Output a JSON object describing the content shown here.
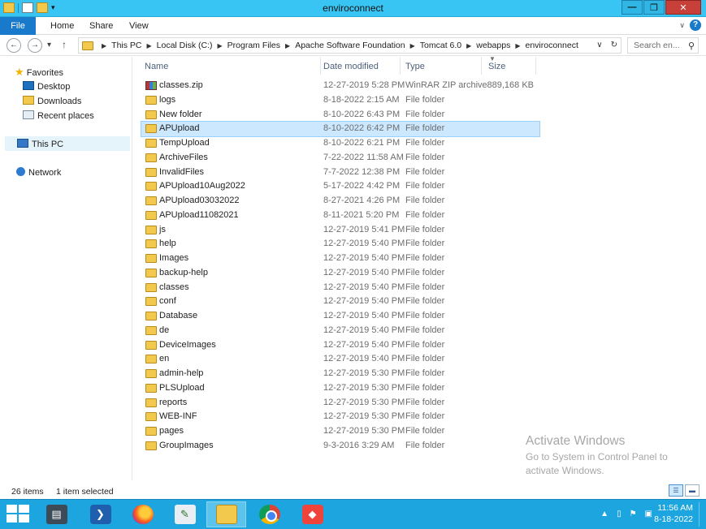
{
  "window": {
    "title": "enviroconnect",
    "controls": {
      "minimize": "—",
      "maximize": "❐",
      "close": "✕"
    }
  },
  "ribbon": {
    "tabs": [
      "File",
      "Home",
      "Share",
      "View"
    ],
    "help": "?"
  },
  "navigation": {
    "back": "←",
    "forward": "→",
    "recent": "▾",
    "up": "↑",
    "breadcrumbs": [
      "This PC",
      "Local Disk (C:)",
      "Program Files",
      "Apache Software Foundation",
      "Tomcat 6.0",
      "webapps",
      "enviroconnect"
    ],
    "dropdown": "∨",
    "refresh": "↻",
    "search_placeholder": "Search en...",
    "search_icon": "search-icon"
  },
  "nav_pane": {
    "favorites_label": "Favorites",
    "favorites": [
      "Desktop",
      "Downloads",
      "Recent places"
    ],
    "this_pc": "This PC",
    "network": "Network"
  },
  "columns": {
    "name": "Name",
    "date": "Date modified",
    "type": "Type",
    "size": "Size"
  },
  "files": [
    {
      "name": "classes.zip",
      "date": "12-27-2019 5:28 PM",
      "type": "WinRAR ZIP archive",
      "size": "889,168 KB",
      "icon": "zip"
    },
    {
      "name": "logs",
      "date": "8-18-2022 2:15 AM",
      "type": "File folder",
      "size": "",
      "icon": "folder"
    },
    {
      "name": "New folder",
      "date": "8-10-2022 6:43 PM",
      "type": "File folder",
      "size": "",
      "icon": "folder"
    },
    {
      "name": "APUpload",
      "date": "8-10-2022 6:42 PM",
      "type": "File folder",
      "size": "",
      "icon": "folder",
      "selected": true
    },
    {
      "name": "TempUpload",
      "date": "8-10-2022 6:21 PM",
      "type": "File folder",
      "size": "",
      "icon": "folder"
    },
    {
      "name": "ArchiveFiles",
      "date": "7-22-2022 11:58 AM",
      "type": "File folder",
      "size": "",
      "icon": "folder"
    },
    {
      "name": "InvalidFiles",
      "date": "7-7-2022 12:38 PM",
      "type": "File folder",
      "size": "",
      "icon": "folder"
    },
    {
      "name": "APUpload10Aug2022",
      "date": "5-17-2022 4:42 PM",
      "type": "File folder",
      "size": "",
      "icon": "folder"
    },
    {
      "name": "APUpload03032022",
      "date": "8-27-2021 4:26 PM",
      "type": "File folder",
      "size": "",
      "icon": "folder"
    },
    {
      "name": "APUpload11082021",
      "date": "8-11-2021 5:20 PM",
      "type": "File folder",
      "size": "",
      "icon": "folder"
    },
    {
      "name": "js",
      "date": "12-27-2019 5:41 PM",
      "type": "File folder",
      "size": "",
      "icon": "folder"
    },
    {
      "name": "help",
      "date": "12-27-2019 5:40 PM",
      "type": "File folder",
      "size": "",
      "icon": "folder"
    },
    {
      "name": "Images",
      "date": "12-27-2019 5:40 PM",
      "type": "File folder",
      "size": "",
      "icon": "folder"
    },
    {
      "name": "backup-help",
      "date": "12-27-2019 5:40 PM",
      "type": "File folder",
      "size": "",
      "icon": "folder"
    },
    {
      "name": "classes",
      "date": "12-27-2019 5:40 PM",
      "type": "File folder",
      "size": "",
      "icon": "folder"
    },
    {
      "name": "conf",
      "date": "12-27-2019 5:40 PM",
      "type": "File folder",
      "size": "",
      "icon": "folder"
    },
    {
      "name": "Database",
      "date": "12-27-2019 5:40 PM",
      "type": "File folder",
      "size": "",
      "icon": "folder"
    },
    {
      "name": "de",
      "date": "12-27-2019 5:40 PM",
      "type": "File folder",
      "size": "",
      "icon": "folder"
    },
    {
      "name": "DeviceImages",
      "date": "12-27-2019 5:40 PM",
      "type": "File folder",
      "size": "",
      "icon": "folder"
    },
    {
      "name": "en",
      "date": "12-27-2019 5:40 PM",
      "type": "File folder",
      "size": "",
      "icon": "folder"
    },
    {
      "name": "admin-help",
      "date": "12-27-2019 5:30 PM",
      "type": "File folder",
      "size": "",
      "icon": "folder"
    },
    {
      "name": "PLSUpload",
      "date": "12-27-2019 5:30 PM",
      "type": "File folder",
      "size": "",
      "icon": "folder"
    },
    {
      "name": "reports",
      "date": "12-27-2019 5:30 PM",
      "type": "File folder",
      "size": "",
      "icon": "folder"
    },
    {
      "name": "WEB-INF",
      "date": "12-27-2019 5:30 PM",
      "type": "File folder",
      "size": "",
      "icon": "folder"
    },
    {
      "name": "pages",
      "date": "12-27-2019 5:30 PM",
      "type": "File folder",
      "size": "",
      "icon": "folder"
    },
    {
      "name": "GroupImages",
      "date": "9-3-2016 3:29 AM",
      "type": "File folder",
      "size": "",
      "icon": "folder"
    }
  ],
  "watermark": {
    "title": "Activate Windows",
    "subtitle": "Go to System in Control Panel to activate Windows."
  },
  "status": {
    "item_count": "26 items",
    "selection": "1 item selected"
  },
  "taskbar": {
    "apps": [
      "server-manager-icon",
      "powershell-icon",
      "firefox-icon",
      "notepad-plus-icon",
      "file-explorer-icon",
      "chrome-icon",
      "anydesk-icon"
    ],
    "tray": {
      "chevron": "▲",
      "network": "▯",
      "flag": "⚑",
      "display": "▣"
    },
    "time": "11:56 AM",
    "date": "8-18-2022"
  },
  "colors": {
    "titlebar": "#39c5f3",
    "taskbar": "#1da5df",
    "file_tab": "#1979ca",
    "selection": "#cce8ff"
  }
}
